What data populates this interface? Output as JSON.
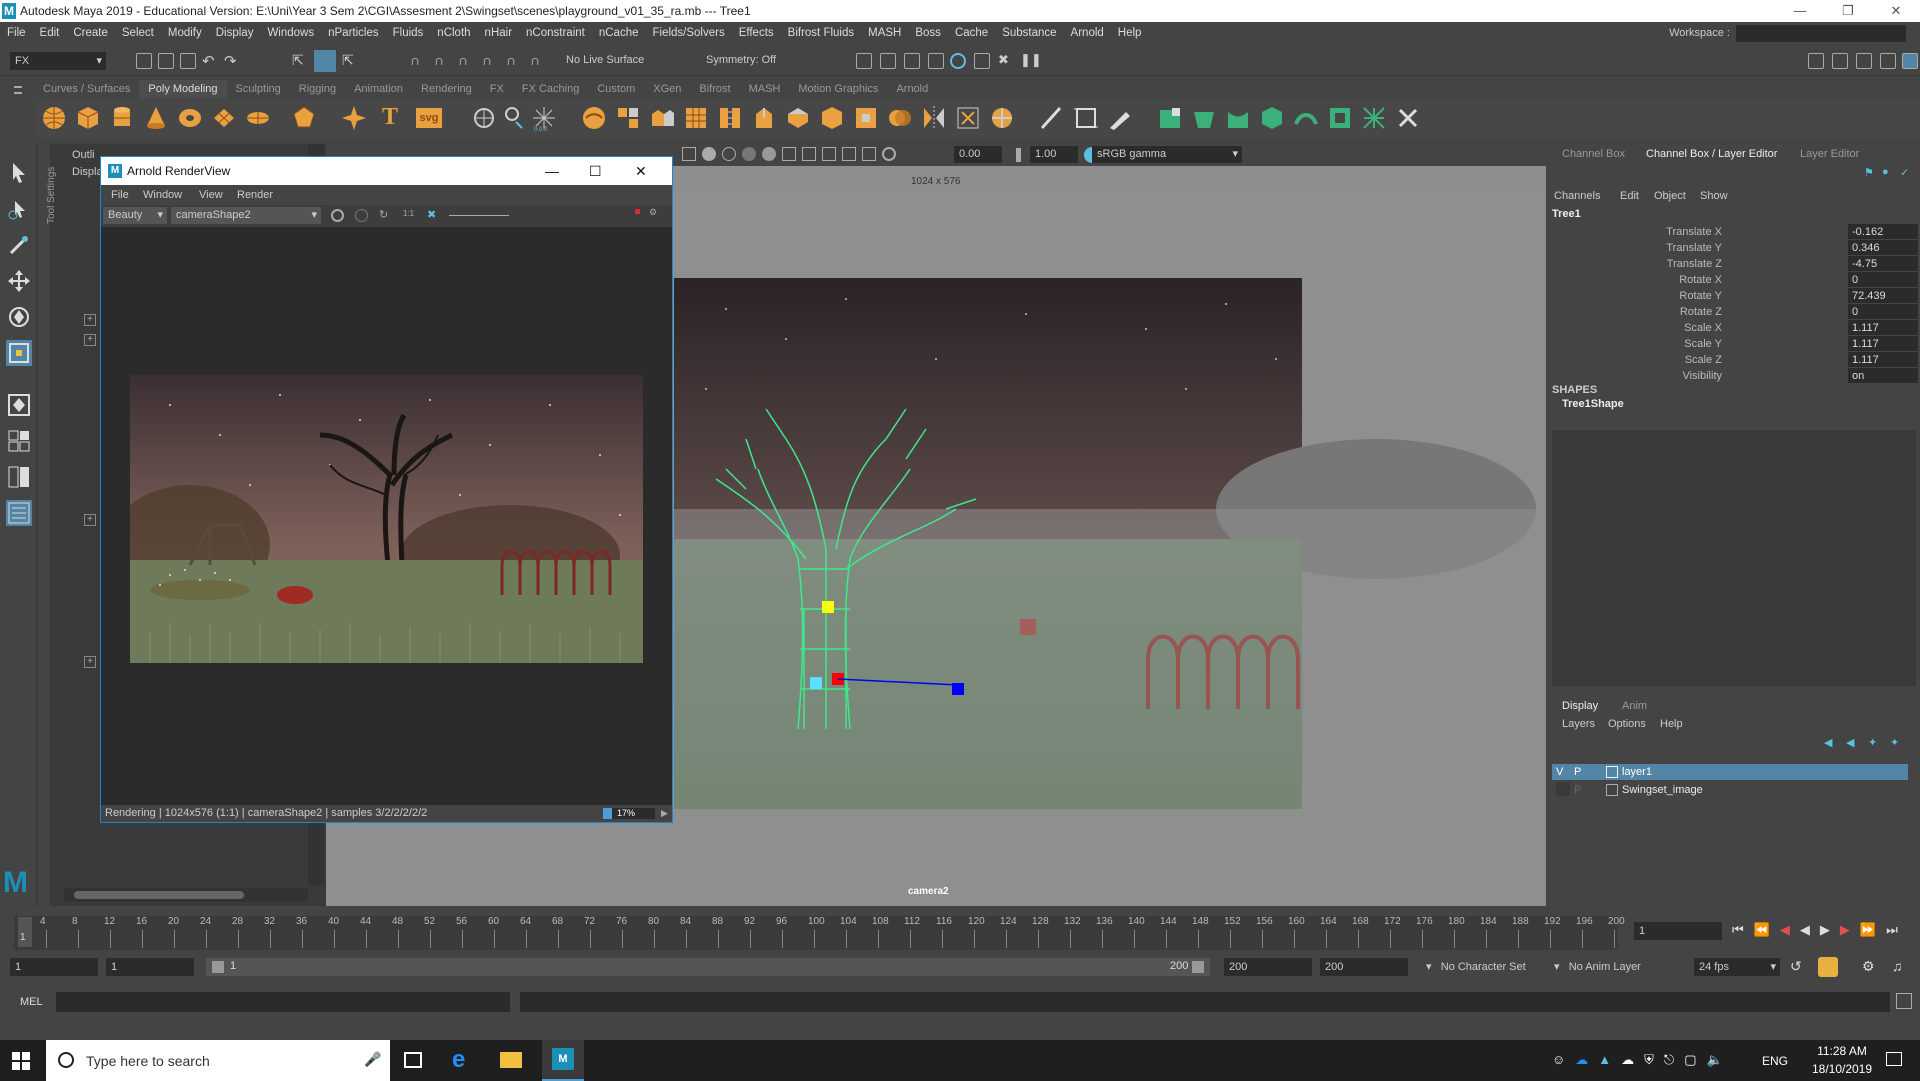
{
  "window": {
    "title": "Autodesk Maya 2019 - Educational Version: E:\\Uni\\Year 3 Sem 2\\CGI\\Assesment 2\\Swingset\\scenes\\playground_v01_35_ra.mb  ---  Tree1",
    "logo": "M"
  },
  "menubar": {
    "items": [
      "File",
      "Edit",
      "Create",
      "Select",
      "Modify",
      "Display",
      "Windows",
      "nParticles",
      "Fluids",
      "nCloth",
      "nHair",
      "nConstraint",
      "nCache",
      "Fields/Solvers",
      "Effects",
      "Bifrost Fluids",
      "MASH",
      "Boss",
      "Cache",
      "Substance",
      "Arnold",
      "Help"
    ],
    "workspace_label": "Workspace :"
  },
  "statusline": {
    "menuset": "FX",
    "live_surface": "No Live Surface",
    "symmetry": "Symmetry: Off"
  },
  "shelf": {
    "tabs": [
      "Curves / Surfaces",
      "Poly Modeling",
      "Sculpting",
      "Rigging",
      "Animation",
      "Rendering",
      "FX",
      "FX Caching",
      "Custom",
      "XGen",
      "Bifrost",
      "MASH",
      "Motion Graphics",
      "Arnold"
    ],
    "active_tab": "Poly Modeling"
  },
  "outliner": {
    "tab": "Outli",
    "menu": "Displa",
    "tool_settings": "Tool Settings"
  },
  "viewport": {
    "resolution": "1024 x 576",
    "exposure": "0.00",
    "gamma": "1.00",
    "color_space": "sRGB gamma",
    "camera": "camera2"
  },
  "arnold_renderview": {
    "title": "Arnold RenderView",
    "menu": [
      "File",
      "Window",
      "View",
      "Render"
    ],
    "aov": "Beauty",
    "camera": "cameraShape2",
    "ratio": "1:1",
    "status": "Rendering | 1024x576 (1:1) | cameraShape2  | samples 3/2/2/2/2/2",
    "progress_text": "17%",
    "progress": 0.17
  },
  "channel_box": {
    "tabs": [
      "Channel Box",
      "Channel Box / Layer Editor",
      "Layer Editor"
    ],
    "menu": [
      "Channels",
      "Edit",
      "Object",
      "Show"
    ],
    "object": "Tree1",
    "attributes": [
      {
        "name": "Translate X",
        "value": "-0.162"
      },
      {
        "name": "Translate Y",
        "value": "0.346"
      },
      {
        "name": "Translate Z",
        "value": "-4.75"
      },
      {
        "name": "Rotate X",
        "value": "0"
      },
      {
        "name": "Rotate Y",
        "value": "72.439"
      },
      {
        "name": "Rotate Z",
        "value": "0"
      },
      {
        "name": "Scale X",
        "value": "1.117"
      },
      {
        "name": "Scale Y",
        "value": "1.117"
      },
      {
        "name": "Scale Z",
        "value": "1.117"
      },
      {
        "name": "Visibility",
        "value": "on"
      }
    ],
    "shapes_heading": "SHAPES",
    "shape": "Tree1Shape"
  },
  "layer_editor": {
    "tabs": [
      "Display",
      "Anim"
    ],
    "menu": [
      "Layers",
      "Options",
      "Help"
    ],
    "layers": [
      {
        "v": "V",
        "p": "P",
        "name": "layer1",
        "selected": true
      },
      {
        "v": "",
        "p": "P",
        "name": "Swingset_image",
        "selected": false
      }
    ]
  },
  "timeslider": {
    "ticks": [
      "4",
      "8",
      "12",
      "16",
      "20",
      "24",
      "28",
      "32",
      "36",
      "40",
      "44",
      "48",
      "52",
      "56",
      "60",
      "64",
      "68",
      "72",
      "76",
      "80",
      "84",
      "88",
      "92",
      "96",
      "100",
      "104",
      "108",
      "112",
      "116",
      "120",
      "124",
      "128",
      "132",
      "136",
      "140",
      "144",
      "148",
      "152",
      "156",
      "160",
      "164",
      "168",
      "172",
      "176",
      "180",
      "184",
      "188",
      "192",
      "196",
      "200"
    ],
    "start_label": "1",
    "current_frame": "1"
  },
  "range": {
    "start": "1",
    "playback_start": "1",
    "slider_start": "1",
    "slider_end": "200",
    "playback_end": "200",
    "end": "200",
    "character_set": "No Character Set",
    "anim_layer": "No Anim Layer",
    "fps": "24 fps"
  },
  "command_line": {
    "label": "MEL"
  },
  "taskbar": {
    "search_placeholder": "Type here to search",
    "language": "ENG",
    "time": "11:28 AM",
    "date": "18/10/2019"
  },
  "colors": {
    "accent": "#4a9fd8",
    "wireframe": "#3fe88a",
    "selection": "#5285a6"
  }
}
